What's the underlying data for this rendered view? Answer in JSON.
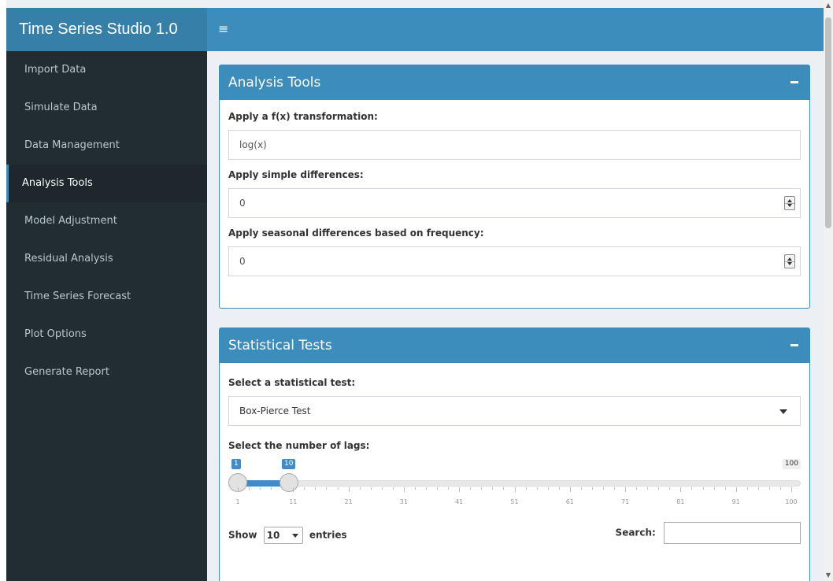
{
  "app": {
    "title": "Time Series Studio 1.0"
  },
  "sidebar": {
    "items": [
      {
        "label": "Import Data"
      },
      {
        "label": "Simulate Data"
      },
      {
        "label": "Data Management"
      },
      {
        "label": "Analysis Tools",
        "active": true
      },
      {
        "label": "Model Adjustment"
      },
      {
        "label": "Residual Analysis"
      },
      {
        "label": "Time Series Forecast"
      },
      {
        "label": "Plot Options"
      },
      {
        "label": "Generate Report"
      }
    ]
  },
  "analysis_tools": {
    "title": "Analysis Tools",
    "transform_label": "Apply a f(x) transformation:",
    "transform_value": "log(x)",
    "diff_label": "Apply simple differences:",
    "diff_value": "0",
    "seasonal_label": "Apply seasonal differences based on frequency:",
    "seasonal_value": "0"
  },
  "statistical_tests": {
    "title": "Statistical Tests",
    "test_label": "Select a statistical test:",
    "test_value": "Box-Pierce Test",
    "lags_label": "Select the number of lags:",
    "lags_from": "1",
    "lags_to": "10",
    "lags_max": "100",
    "tick_labels": [
      "1",
      "11",
      "21",
      "31",
      "41",
      "51",
      "61",
      "71",
      "81",
      "91",
      "100"
    ],
    "show_label": "Show",
    "entries_value": "10",
    "entries_label": "entries",
    "search_label": "Search:"
  },
  "colors": {
    "header": "#3c8dbc",
    "logo": "#367fa9",
    "sidebar": "#222d32"
  }
}
